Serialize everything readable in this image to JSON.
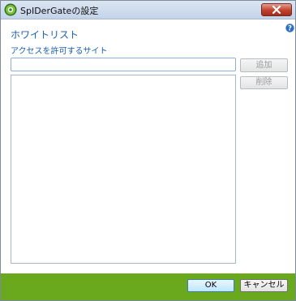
{
  "window": {
    "title": "SpIDerGateの設定"
  },
  "section": {
    "heading": "ホワイトリスト",
    "sublabel": "アクセスを許可するサイト"
  },
  "url_input": {
    "value": "",
    "placeholder": ""
  },
  "buttons": {
    "add_label": "追加",
    "delete_label": "削除",
    "ok_label": "OK",
    "cancel_label": "キャンセル"
  },
  "whitelist_items": [],
  "icons": {
    "app": "spidergate-app-icon",
    "close": "close-icon",
    "help": "help-icon"
  },
  "colors": {
    "accent_text": "#1b5fb0",
    "footer": "#6aa81e",
    "close_button": "#c2412b"
  }
}
